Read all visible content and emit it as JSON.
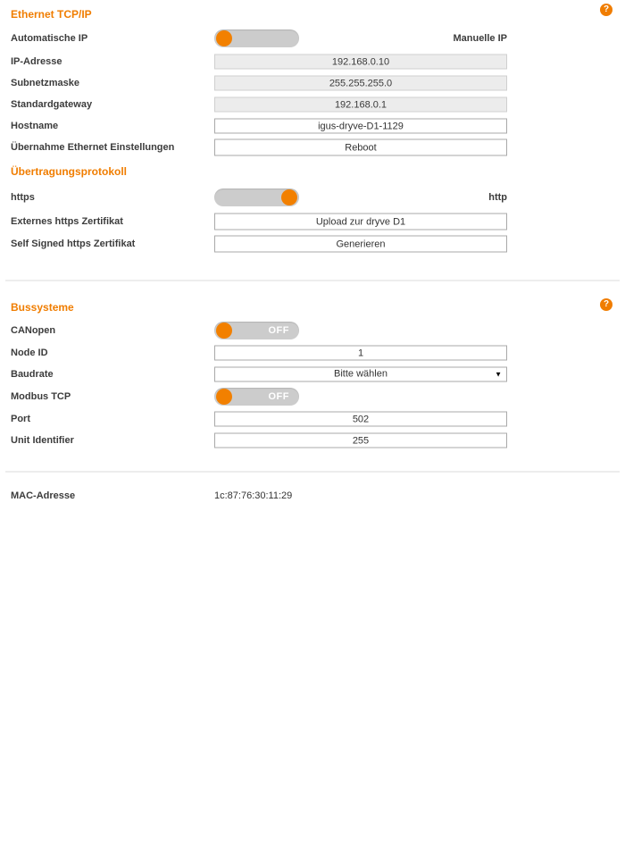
{
  "accent": "#f07d00",
  "help_icon_glyph": "?",
  "select_arrow_glyph": "▼",
  "ethernet": {
    "title": "Ethernet TCP/IP",
    "auto_ip_label": "Automatische IP",
    "manual_ip_label": "Manuelle IP",
    "ip_label": "IP-Adresse",
    "ip_value": "192.168.0.10",
    "subnet_label": "Subnetzmaske",
    "subnet_value": "255.255.255.0",
    "gateway_label": "Standardgateway",
    "gateway_value": "192.168.0.1",
    "hostname_label": "Hostname",
    "hostname_value": "igus-dryve-D1-1129",
    "apply_label": "Übernahme Ethernet Einstellungen",
    "apply_button": "Reboot"
  },
  "protocol": {
    "title": "Übertragungsprotokoll",
    "https_label": "https",
    "http_label": "http",
    "external_cert_label": "Externes https Zertifikat",
    "external_cert_button": "Upload zur dryve D1",
    "self_signed_label": "Self Signed https Zertifikat",
    "self_signed_button": "Generieren"
  },
  "bus": {
    "title": "Bussysteme",
    "canopen_label": "CANopen",
    "canopen_state": "OFF",
    "node_id_label": "Node ID",
    "node_id_value": "1",
    "baudrate_label": "Baudrate",
    "baudrate_value": "Bitte wählen",
    "modbus_label": "Modbus TCP",
    "modbus_state": "OFF",
    "port_label": "Port",
    "port_value": "502",
    "unit_label": "Unit Identifier",
    "unit_value": "255"
  },
  "mac": {
    "label": "MAC-Adresse",
    "value": "1c:87:76:30:11:29"
  }
}
